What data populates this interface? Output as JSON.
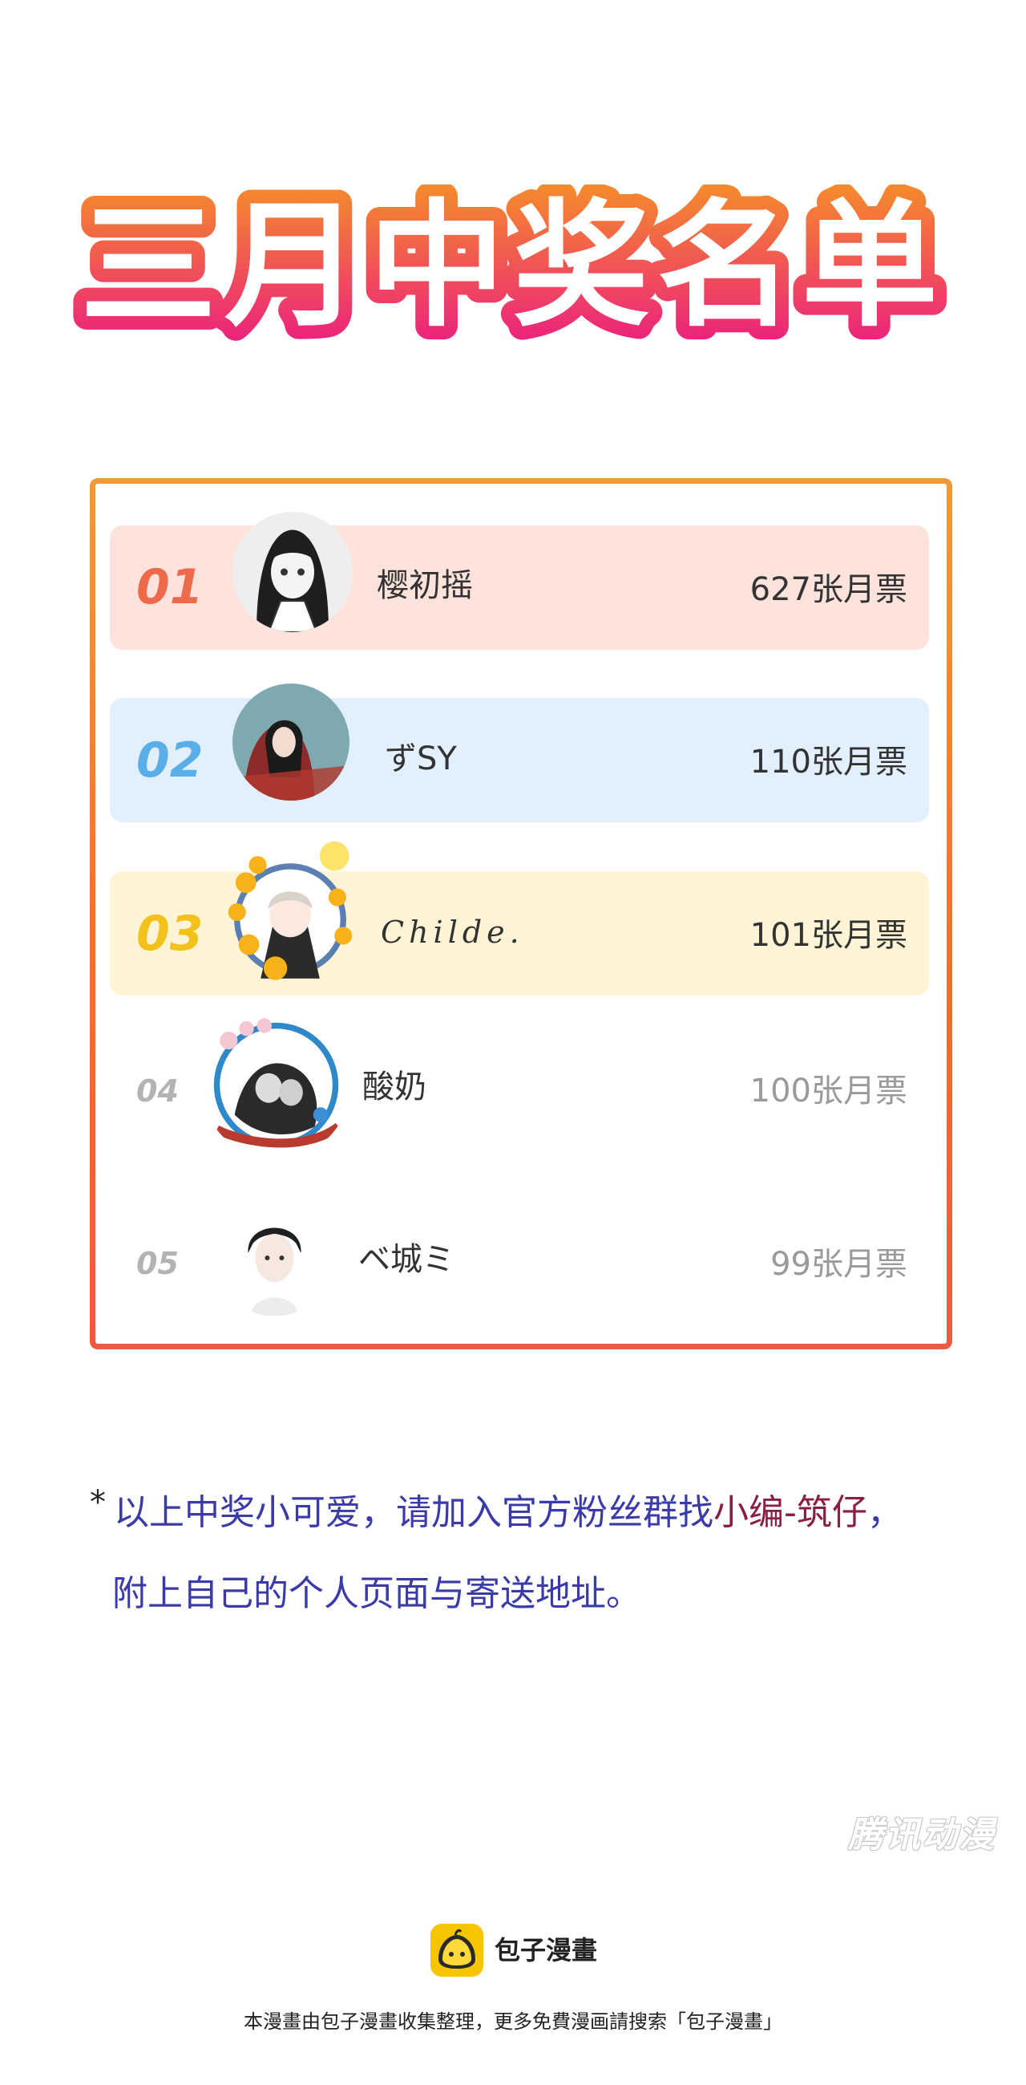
{
  "title": "三月中奖名单",
  "ranking": [
    {
      "rank": "01",
      "name": "樱初摇",
      "votes": "627张月票",
      "rank_color": "#ef6a4a",
      "bg": "#fde3dc"
    },
    {
      "rank": "02",
      "name": "ずSY",
      "votes": "110张月票",
      "rank_color": "#5aaee8",
      "bg": "#e2effc"
    },
    {
      "rank": "03",
      "name": "Childe.",
      "votes": "101张月票",
      "rank_color": "#f2c21b",
      "bg": "#fff5d6"
    },
    {
      "rank": "04",
      "name": "酸奶",
      "votes": "100张月票"
    },
    {
      "rank": "05",
      "name": "ベ城ミ",
      "votes": "99张月票"
    }
  ],
  "note": {
    "star": "*",
    "line1_prefix": "以上中奖小可爱，请加入官方粉丝群找",
    "line1_highlight": "小编-筑仔",
    "line1_suffix": "，",
    "line2": "附上自己的个人页面与寄送地址。"
  },
  "watermark": "腾讯动漫",
  "brand": "包子漫畫",
  "footer": "本漫畫由包子漫畫收集整理，更多免費漫画請搜索「包子漫畫」",
  "colors": {
    "title_gradient_top": "#f58a2c",
    "title_gradient_bottom": "#ec1f7f",
    "frame": "#f0702e",
    "note_text": "#3a3aa8",
    "note_highlight": "#8a1f44",
    "logo_yellow": "#f7c500"
  }
}
